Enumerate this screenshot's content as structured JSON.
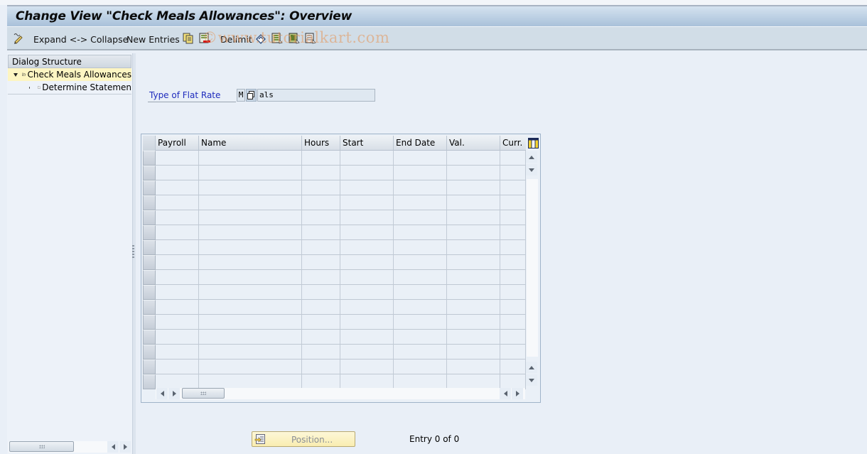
{
  "window": {
    "title": "Change View \"Check Meals Allowances\": Overview"
  },
  "toolbar": {
    "expand_collapse_label": "Expand <-> Collapse",
    "new_entries_label": "New Entries",
    "delimit_label": "Delimit",
    "icons": [
      "edit-toggle-icon",
      "copy-icon",
      "delete-icon",
      "undo-icon",
      "select-all-icon",
      "select-block-icon",
      "deselect-all-icon"
    ]
  },
  "watermark": "©www.tutorialkart.com",
  "dialog_structure": {
    "header": "Dialog Structure",
    "items": [
      {
        "label": "Check Meals Allowances",
        "level": 0,
        "expanded": true,
        "selected": true
      },
      {
        "label": "Determine Statemen",
        "level": 1,
        "expanded": false,
        "selected": false
      }
    ]
  },
  "form": {
    "type_of_flat_rate_label": "Type of Flat Rate",
    "type_of_flat_rate_key": "M",
    "type_of_flat_rate_text": "als"
  },
  "table": {
    "columns": [
      "Payroll",
      "Name",
      "Hours",
      "Start",
      "End Date",
      "Val.",
      "Curr."
    ],
    "rows": [],
    "visible_empty_rows": 16
  },
  "footer": {
    "position_button_label": "Position...",
    "entry_status": "Entry 0 of 0"
  },
  "colors": {
    "title_bar": "#a9c1da",
    "toolbar": "#d1dde7",
    "background": "#e9eff7",
    "label_blue": "#1e2bbd",
    "selected_tree": "#fdf5c2",
    "position_button": "#f9edb0"
  }
}
